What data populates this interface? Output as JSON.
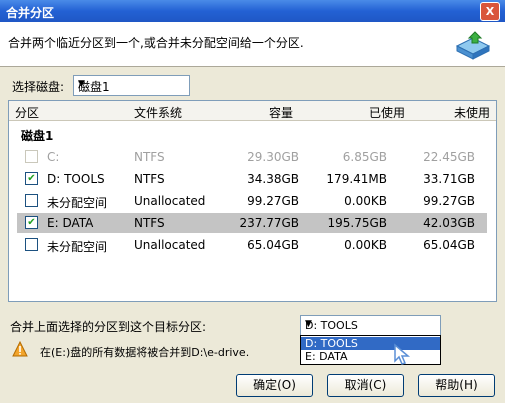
{
  "window": {
    "title": "合并分区",
    "close_label": "X"
  },
  "header": {
    "description": "合并两个临近分区到一个,或合并未分配空间给一个分区.",
    "logo_icon": "merge-partition-icon"
  },
  "disk_selector": {
    "label": "选择磁盘:",
    "value": "磁盘1"
  },
  "table": {
    "columns": [
      "分区",
      "文件系统",
      "容量",
      "已使用",
      "未使用"
    ],
    "group": "磁盘1",
    "rows": [
      {
        "name": "C:",
        "fs": "NTFS",
        "capacity": "29.30GB",
        "used": "6.85GB",
        "free": "22.45GB",
        "checked": false,
        "disabled": true,
        "selected": false
      },
      {
        "name": "D:  TOOLS",
        "fs": "NTFS",
        "capacity": "34.38GB",
        "used": "179.41MB",
        "free": "33.71GB",
        "checked": true,
        "disabled": false,
        "selected": false
      },
      {
        "name": "未分配空间",
        "fs": "Unallocated",
        "capacity": "99.27GB",
        "used": "0.00KB",
        "free": "99.27GB",
        "checked": false,
        "disabled": false,
        "selected": false
      },
      {
        "name": "E:  DATA",
        "fs": "NTFS",
        "capacity": "237.77GB",
        "used": "195.75GB",
        "free": "42.03GB",
        "checked": true,
        "disabled": false,
        "selected": true
      },
      {
        "name": "未分配空间",
        "fs": "Unallocated",
        "capacity": "65.04GB",
        "used": "0.00KB",
        "free": "65.04GB",
        "checked": false,
        "disabled": false,
        "selected": false
      }
    ]
  },
  "merge": {
    "label": "合并上面选择的分区到这个目标分区:",
    "selected": "D:  TOOLS",
    "options": [
      "D:  TOOLS",
      "E:  DATA"
    ],
    "highlighted_index": 0
  },
  "warning": {
    "icon": "warning-icon",
    "text": "在(E:)盘的所有数据将被合并到D:\\e-drive."
  },
  "buttons": {
    "ok": "确定(O)",
    "cancel": "取消(C)",
    "help": "帮助(H)"
  },
  "colors": {
    "title_bar": "#2361d4",
    "selection": "#316ac5",
    "check": "#21a121"
  }
}
